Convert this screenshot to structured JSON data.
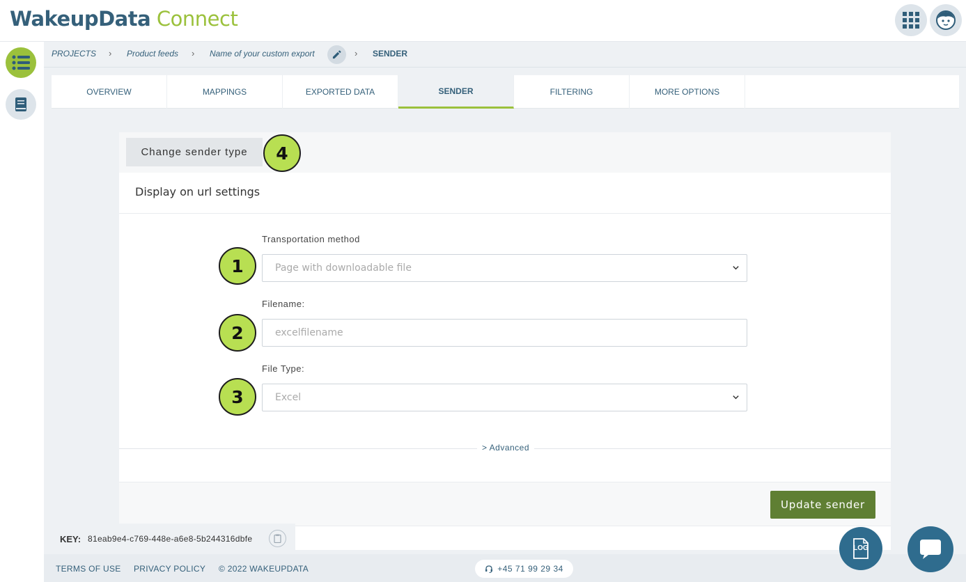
{
  "header": {
    "logo_primary": "WakeupData",
    "logo_secondary": "Connect",
    "apps_icon": "grid-icon",
    "profile_icon": "avatar-face-icon"
  },
  "sidebar": {
    "items": [
      {
        "icon": "list-icon",
        "active": true
      },
      {
        "icon": "book-icon",
        "active": false
      }
    ]
  },
  "breadcrumb": {
    "items": [
      "PROJECTS",
      "Product feeds",
      "Name of your custom export"
    ],
    "current": "SENDER",
    "edit_icon": "pencil-icon"
  },
  "tabs": [
    {
      "label": "OVERVIEW"
    },
    {
      "label": "MAPPINGS"
    },
    {
      "label": "EXPORTED DATA"
    },
    {
      "label": "SENDER",
      "active": true
    },
    {
      "label": "FILTERING"
    },
    {
      "label": "MORE OPTIONS"
    }
  ],
  "panel": {
    "change_sender_label": "Change sender type",
    "section_title": "Display on url settings",
    "transport_label": "Transportation method",
    "transport_value": "Page with downloadable file",
    "filename_label": "Filename:",
    "filename_placeholder": "excelfilename",
    "filetype_label": "File Type:",
    "filetype_value": "Excel",
    "advanced_label": "> Advanced",
    "update_label": "Update sender"
  },
  "badges": [
    "1",
    "2",
    "3",
    "4"
  ],
  "key": {
    "label": "KEY:",
    "value": "81eab9e4-c769-448e-a6e8-5b244316dbfe"
  },
  "footer": {
    "terms": "TERMS OF USE",
    "privacy": "PRIVACY POLICY",
    "copyright": "© 2022 WAKEUPDATA",
    "phone": "+45 71 99 29 34"
  },
  "fab": {
    "log_label": "LOG"
  },
  "colors": {
    "brand_blue": "#35607a",
    "brand_green": "#9bc13c",
    "button_green": "#5f7f33",
    "badge_green": "#b8df52"
  }
}
